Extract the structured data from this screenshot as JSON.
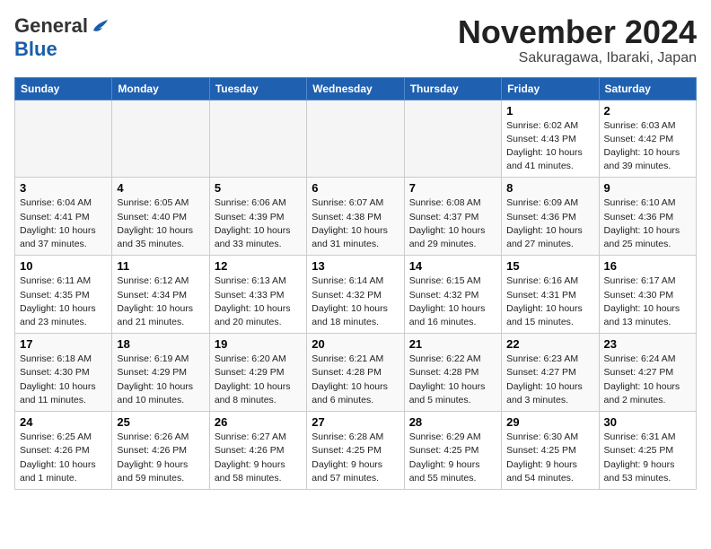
{
  "logo": {
    "general": "General",
    "blue": "Blue"
  },
  "header": {
    "month": "November 2024",
    "location": "Sakuragawa, Ibaraki, Japan"
  },
  "weekdays": [
    "Sunday",
    "Monday",
    "Tuesday",
    "Wednesday",
    "Thursday",
    "Friday",
    "Saturday"
  ],
  "weeks": [
    [
      {
        "day": "",
        "info": ""
      },
      {
        "day": "",
        "info": ""
      },
      {
        "day": "",
        "info": ""
      },
      {
        "day": "",
        "info": ""
      },
      {
        "day": "",
        "info": ""
      },
      {
        "day": "1",
        "info": "Sunrise: 6:02 AM\nSunset: 4:43 PM\nDaylight: 10 hours and 41 minutes."
      },
      {
        "day": "2",
        "info": "Sunrise: 6:03 AM\nSunset: 4:42 PM\nDaylight: 10 hours and 39 minutes."
      }
    ],
    [
      {
        "day": "3",
        "info": "Sunrise: 6:04 AM\nSunset: 4:41 PM\nDaylight: 10 hours and 37 minutes."
      },
      {
        "day": "4",
        "info": "Sunrise: 6:05 AM\nSunset: 4:40 PM\nDaylight: 10 hours and 35 minutes."
      },
      {
        "day": "5",
        "info": "Sunrise: 6:06 AM\nSunset: 4:39 PM\nDaylight: 10 hours and 33 minutes."
      },
      {
        "day": "6",
        "info": "Sunrise: 6:07 AM\nSunset: 4:38 PM\nDaylight: 10 hours and 31 minutes."
      },
      {
        "day": "7",
        "info": "Sunrise: 6:08 AM\nSunset: 4:37 PM\nDaylight: 10 hours and 29 minutes."
      },
      {
        "day": "8",
        "info": "Sunrise: 6:09 AM\nSunset: 4:36 PM\nDaylight: 10 hours and 27 minutes."
      },
      {
        "day": "9",
        "info": "Sunrise: 6:10 AM\nSunset: 4:36 PM\nDaylight: 10 hours and 25 minutes."
      }
    ],
    [
      {
        "day": "10",
        "info": "Sunrise: 6:11 AM\nSunset: 4:35 PM\nDaylight: 10 hours and 23 minutes."
      },
      {
        "day": "11",
        "info": "Sunrise: 6:12 AM\nSunset: 4:34 PM\nDaylight: 10 hours and 21 minutes."
      },
      {
        "day": "12",
        "info": "Sunrise: 6:13 AM\nSunset: 4:33 PM\nDaylight: 10 hours and 20 minutes."
      },
      {
        "day": "13",
        "info": "Sunrise: 6:14 AM\nSunset: 4:32 PM\nDaylight: 10 hours and 18 minutes."
      },
      {
        "day": "14",
        "info": "Sunrise: 6:15 AM\nSunset: 4:32 PM\nDaylight: 10 hours and 16 minutes."
      },
      {
        "day": "15",
        "info": "Sunrise: 6:16 AM\nSunset: 4:31 PM\nDaylight: 10 hours and 15 minutes."
      },
      {
        "day": "16",
        "info": "Sunrise: 6:17 AM\nSunset: 4:30 PM\nDaylight: 10 hours and 13 minutes."
      }
    ],
    [
      {
        "day": "17",
        "info": "Sunrise: 6:18 AM\nSunset: 4:30 PM\nDaylight: 10 hours and 11 minutes."
      },
      {
        "day": "18",
        "info": "Sunrise: 6:19 AM\nSunset: 4:29 PM\nDaylight: 10 hours and 10 minutes."
      },
      {
        "day": "19",
        "info": "Sunrise: 6:20 AM\nSunset: 4:29 PM\nDaylight: 10 hours and 8 minutes."
      },
      {
        "day": "20",
        "info": "Sunrise: 6:21 AM\nSunset: 4:28 PM\nDaylight: 10 hours and 6 minutes."
      },
      {
        "day": "21",
        "info": "Sunrise: 6:22 AM\nSunset: 4:28 PM\nDaylight: 10 hours and 5 minutes."
      },
      {
        "day": "22",
        "info": "Sunrise: 6:23 AM\nSunset: 4:27 PM\nDaylight: 10 hours and 3 minutes."
      },
      {
        "day": "23",
        "info": "Sunrise: 6:24 AM\nSunset: 4:27 PM\nDaylight: 10 hours and 2 minutes."
      }
    ],
    [
      {
        "day": "24",
        "info": "Sunrise: 6:25 AM\nSunset: 4:26 PM\nDaylight: 10 hours and 1 minute."
      },
      {
        "day": "25",
        "info": "Sunrise: 6:26 AM\nSunset: 4:26 PM\nDaylight: 9 hours and 59 minutes."
      },
      {
        "day": "26",
        "info": "Sunrise: 6:27 AM\nSunset: 4:26 PM\nDaylight: 9 hours and 58 minutes."
      },
      {
        "day": "27",
        "info": "Sunrise: 6:28 AM\nSunset: 4:25 PM\nDaylight: 9 hours and 57 minutes."
      },
      {
        "day": "28",
        "info": "Sunrise: 6:29 AM\nSunset: 4:25 PM\nDaylight: 9 hours and 55 minutes."
      },
      {
        "day": "29",
        "info": "Sunrise: 6:30 AM\nSunset: 4:25 PM\nDaylight: 9 hours and 54 minutes."
      },
      {
        "day": "30",
        "info": "Sunrise: 6:31 AM\nSunset: 4:25 PM\nDaylight: 9 hours and 53 minutes."
      }
    ]
  ]
}
